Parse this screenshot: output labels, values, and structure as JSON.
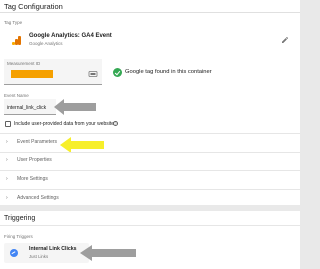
{
  "tag_configuration": {
    "title": "Tag Configuration",
    "tag_type_label": "Tag Type",
    "tag_name": "Google Analytics: GA4 Event",
    "tag_sub": "Google Analytics",
    "measurement_id_label": "Measurement ID",
    "measurement_id_value_redacted": true,
    "google_tag_status": "Google tag found in this container",
    "event_name_label": "Event Name",
    "event_name_value": "internal_link_click",
    "include_user_provided_label": "Include user-provided data from your website",
    "include_user_provided_checked": false,
    "sections": [
      {
        "label": "Event Parameters"
      },
      {
        "label": "User Properties"
      },
      {
        "label": "More Settings"
      },
      {
        "label": "Advanced Settings"
      }
    ]
  },
  "triggering": {
    "title": "Triggering",
    "firing_triggers_label": "Firing Triggers",
    "trigger_name": "Internal Link Clicks",
    "trigger_sub": "Just Links"
  },
  "colors": {
    "redaction": "#f5a000",
    "success": "#34a853",
    "trigger_icon": "#4285f4",
    "highlight_arrow": "#f7ef2a",
    "gray_arrow": "#9e9e9e"
  },
  "icons": {
    "tag_type": "google-analytics-icon",
    "edit": "pencil-icon",
    "variable_picker": "variable-picker-icon",
    "status": "check-circle-icon",
    "help": "help-icon",
    "chevron": "chevron-right-icon",
    "trigger": "link-click-trigger-icon"
  }
}
